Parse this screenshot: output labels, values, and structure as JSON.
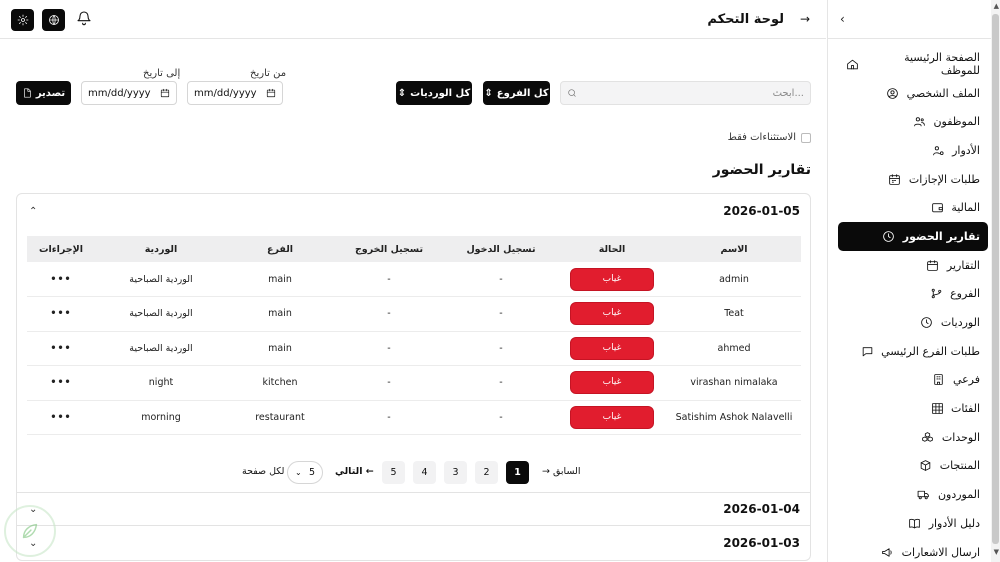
{
  "header": {
    "title": "لوحة التحكم"
  },
  "sidebar": {
    "items": [
      {
        "label": "الصفحة الرئيسية للموظف",
        "icon": "home-icon"
      },
      {
        "label": "الملف الشخصي",
        "icon": "user-circle-icon"
      },
      {
        "label": "الموظفون",
        "icon": "users-icon"
      },
      {
        "label": "الأدوار",
        "icon": "user-cog-icon"
      },
      {
        "label": "طلبات الإجازات",
        "icon": "calendar-icon"
      },
      {
        "label": "المالية",
        "icon": "wallet-icon"
      },
      {
        "label": "تقارير الحضور",
        "icon": "clock-icon",
        "active": true
      },
      {
        "label": "التقارير",
        "icon": "calendar-grid-icon"
      },
      {
        "label": "الفروع",
        "icon": "git-branch-icon"
      },
      {
        "label": "الورديات",
        "icon": "clock-icon"
      },
      {
        "label": "طلبات الفرع الرئيسي",
        "icon": "chat-icon"
      },
      {
        "label": "فرعي",
        "icon": "building-icon"
      },
      {
        "label": "الفئات",
        "icon": "grid-icon"
      },
      {
        "label": "الوحدات",
        "icon": "boxes-icon"
      },
      {
        "label": "المنتجات",
        "icon": "package-icon"
      },
      {
        "label": "الموردون",
        "icon": "truck-icon"
      },
      {
        "label": "دليل الأدوار",
        "icon": "book-icon"
      },
      {
        "label": "ارسال الاشعارات",
        "icon": "megaphone-icon"
      }
    ]
  },
  "filters": {
    "search_placeholder": "ابحث...",
    "branches_label": "كل الفروع",
    "shifts_label": "كل الورديات",
    "from_label": "من تاريخ",
    "to_label": "إلى تاريخ",
    "date_placeholder": "mm/dd/yyyy",
    "export_label": "تصدير",
    "exceptions_only": "الاستثناءات فقط"
  },
  "section_title": "تقارير الحضور",
  "table": {
    "headers": [
      "الاسم",
      "الحالة",
      "تسجيل الدخول",
      "تسجيل الخروج",
      "الفرع",
      "الوردية",
      "الإجراءات"
    ],
    "rows": [
      {
        "name": "admin",
        "status": "غياب",
        "check_in": "-",
        "check_out": "-",
        "branch": "main",
        "shift": "الوردية الصباحية",
        "actions": "•••"
      },
      {
        "name": "Teat",
        "status": "غياب",
        "check_in": "-",
        "check_out": "-",
        "branch": "main",
        "shift": "الوردية الصباحية",
        "actions": "•••"
      },
      {
        "name": "ahmed",
        "status": "غياب",
        "check_in": "-",
        "check_out": "-",
        "branch": "main",
        "shift": "الوردية الصباحية",
        "actions": "•••"
      },
      {
        "name": "virashan nimalaka",
        "status": "غياب",
        "check_in": "-",
        "check_out": "-",
        "branch": "kitchen",
        "shift": "night",
        "actions": "•••"
      },
      {
        "name": "Satishim Ashok Nalavelli",
        "status": "غياب",
        "check_in": "-",
        "check_out": "-",
        "branch": "restaurant",
        "shift": "morning",
        "actions": "•••"
      }
    ]
  },
  "groups": [
    "2026-01-05",
    "2026-01-04",
    "2026-01-03"
  ],
  "pagination": {
    "prev": "→ السابق",
    "next": "التالي ←",
    "pages": [
      "1",
      "2",
      "3",
      "4",
      "5"
    ],
    "current": "1",
    "per_page_value": "5",
    "per_page_label": "لكل صفحة"
  },
  "colors": {
    "accent": "#0a0a0a",
    "absent": "#e11d2e"
  }
}
